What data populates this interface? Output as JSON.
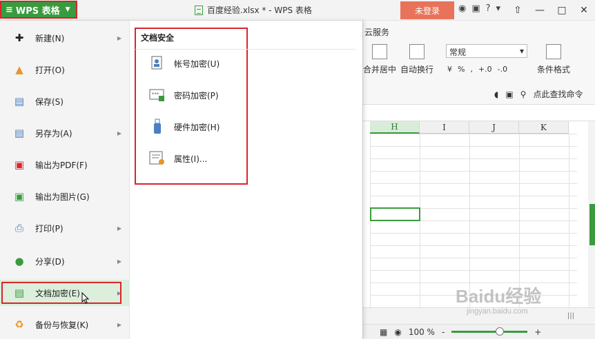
{
  "titlebar": {
    "app_button": "WPS 表格",
    "doc_title": "百度经验.xlsx * - WPS 表格",
    "login_label": "未登录"
  },
  "menu": {
    "items": [
      {
        "label": "新建(N)",
        "icon": "new-file-icon",
        "has_arrow": true
      },
      {
        "label": "打开(O)",
        "icon": "folder-open-icon",
        "has_arrow": false
      },
      {
        "label": "保存(S)",
        "icon": "save-icon",
        "has_arrow": false
      },
      {
        "label": "另存为(A)",
        "icon": "save-as-icon",
        "has_arrow": true
      },
      {
        "label": "输出为PDF(F)",
        "icon": "pdf-icon",
        "has_arrow": false
      },
      {
        "label": "输出为图片(G)",
        "icon": "image-export-icon",
        "has_arrow": false
      },
      {
        "label": "打印(P)",
        "icon": "printer-icon",
        "has_arrow": true
      },
      {
        "label": "分享(D)",
        "icon": "share-icon",
        "has_arrow": true
      },
      {
        "label": "文档加密(E)",
        "icon": "doc-encrypt-icon",
        "has_arrow": true
      },
      {
        "label": "备份与恢复(K)",
        "icon": "backup-icon",
        "has_arrow": true
      }
    ],
    "active_index": 8
  },
  "submenu": {
    "title": "文档安全",
    "items": [
      {
        "label": "帐号加密(U)",
        "icon": "account-encrypt-icon"
      },
      {
        "label": "密码加密(P)",
        "icon": "password-encrypt-icon"
      },
      {
        "label": "硬件加密(H)",
        "icon": "usb-key-icon"
      },
      {
        "label": "属性(I)...",
        "icon": "properties-icon"
      }
    ]
  },
  "ribbon": {
    "tab_cloud": "云服务",
    "merge_center": "合并居中",
    "wrap_text": "自动换行",
    "number_format": "常规",
    "conditional_format": "条件格式",
    "find_command": "点此查找命令",
    "percent": "%",
    "comma": ",",
    "inc_decimal": ".00\n+.0",
    "dec_decimal": ".00\n-.0"
  },
  "sheet": {
    "columns": [
      "H",
      "I",
      "J",
      "K"
    ],
    "active_column": "H"
  },
  "statusbar": {
    "zoom": "100 %",
    "minus": "-",
    "plus": "+"
  },
  "watermark": {
    "text": "Baidu经验",
    "sub": "jingyan.baidu.com"
  },
  "colors": {
    "brand_green": "#3a9b3e",
    "highlight_red": "#d9242b",
    "login_orange": "#e8735a"
  }
}
